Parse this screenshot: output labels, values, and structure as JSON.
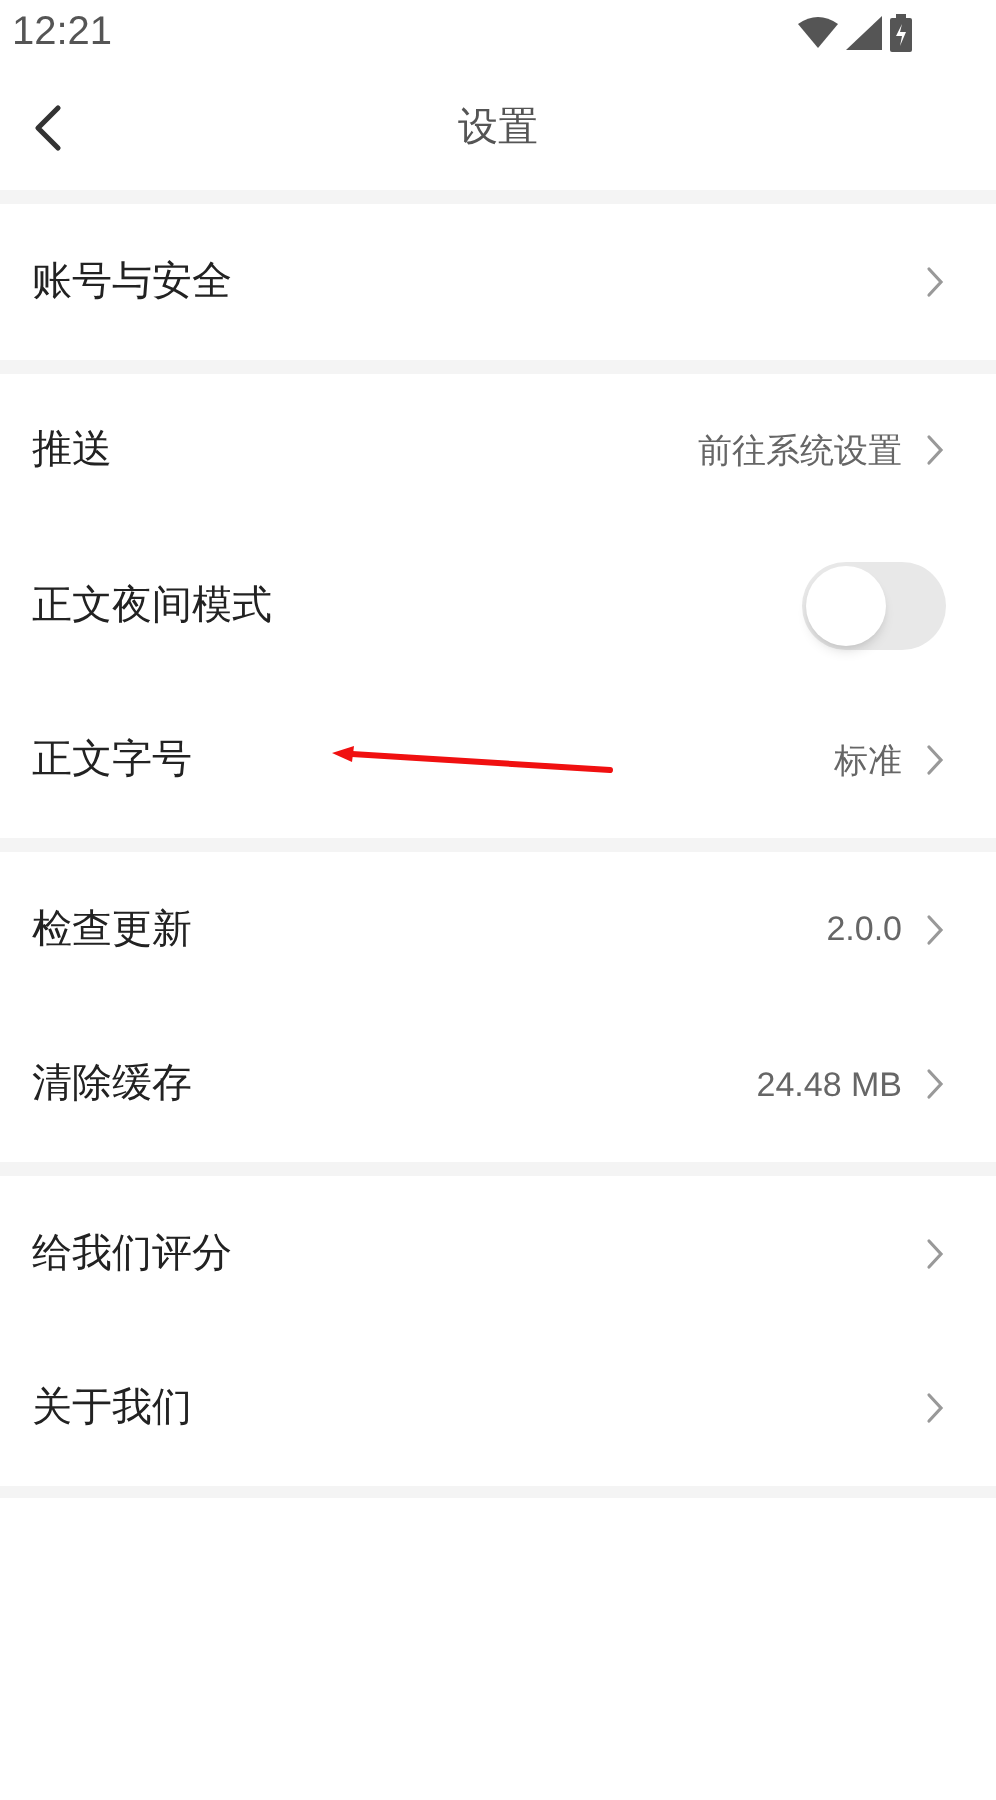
{
  "status_bar": {
    "time": "12:21"
  },
  "header": {
    "title": "设置"
  },
  "groups": [
    {
      "rows": [
        {
          "kind": "link",
          "label": "账号与安全"
        }
      ]
    },
    {
      "rows": [
        {
          "kind": "link",
          "label": "推送",
          "value": "前往系统设置"
        },
        {
          "kind": "toggle",
          "label": "正文夜间模式",
          "on": false
        },
        {
          "kind": "link",
          "label": "正文字号",
          "value": "标准"
        }
      ]
    },
    {
      "rows": [
        {
          "kind": "link",
          "label": "检查更新",
          "value": "2.0.0"
        },
        {
          "kind": "link",
          "label": "清除缓存",
          "value": "24.48 MB"
        }
      ]
    },
    {
      "rows": [
        {
          "kind": "link",
          "label": "给我们评分"
        },
        {
          "kind": "link",
          "label": "关于我们"
        }
      ]
    }
  ]
}
